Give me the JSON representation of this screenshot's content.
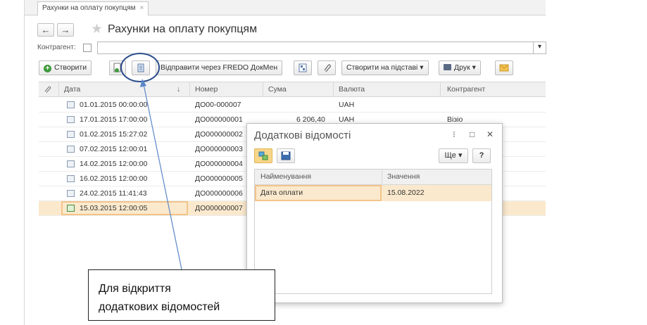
{
  "tab": {
    "label": "Рахунки на оплату покупцям",
    "close": "×"
  },
  "nav": {
    "back": "←",
    "forward": "→",
    "favorite": "★"
  },
  "page_title": "Рахунки на оплату покупцям",
  "filter": {
    "label": "Контрагент:",
    "value": "",
    "dropdown": "▾"
  },
  "toolbar": {
    "create": "Створити",
    "send_fredo": "Відправити через FREDO ДокМен",
    "create_based": "Створити на підставі ▾",
    "print": "Друк ▾"
  },
  "columns": [
    "Дата",
    "Номер",
    "Сума",
    "Валюта",
    "Контрагент"
  ],
  "sort_indicator": "↓",
  "rows": [
    {
      "date": "01.01.2015 00:00:00",
      "number": "ДО00-000007",
      "sum": "",
      "currency": "UAH",
      "counterparty": ""
    },
    {
      "date": "17.01.2015 17:00:00",
      "number": "ДО000000001",
      "sum": "6 206,40",
      "currency": "UAH",
      "counterparty": "Візіо"
    },
    {
      "date": "01.02.2015 15:27:02",
      "number": "ДО000000002",
      "sum": "",
      "currency": "",
      "counterparty": ""
    },
    {
      "date": "07.02.2015 12:00:01",
      "number": "ДО000000003",
      "sum": "",
      "currency": "",
      "counterparty": ""
    },
    {
      "date": "14.02.2015 12:00:00",
      "number": "ДО000000004",
      "sum": "",
      "currency": "",
      "counterparty": ""
    },
    {
      "date": "16.02.2015 12:00:00",
      "number": "ДО000000005",
      "sum": "",
      "currency": "",
      "counterparty": ""
    },
    {
      "date": "24.02.2015 11:41:43",
      "number": "ДО000000006",
      "sum": "",
      "currency": "",
      "counterparty": ""
    },
    {
      "date": "15.03.2015 12:00:05",
      "number": "ДО000000007",
      "sum": "",
      "currency": "",
      "counterparty": ""
    }
  ],
  "dialog": {
    "title": "Додаткові відомості",
    "menu": "⁝",
    "maximize": "□",
    "close": "✕",
    "more": "Ще ▾",
    "help": "?",
    "columns": [
      "Найменування",
      "Значення"
    ],
    "row": {
      "name": "Дата оплати",
      "value": "15.08.2022"
    }
  },
  "callout": {
    "line1": "Для відкриття",
    "line2": "додаткових відомостей"
  },
  "colors": {
    "selection": "#fbe9cd",
    "selection_border": "#f3c48a",
    "annotation": "#2b4c8c",
    "arrow": "#5b86c8"
  }
}
